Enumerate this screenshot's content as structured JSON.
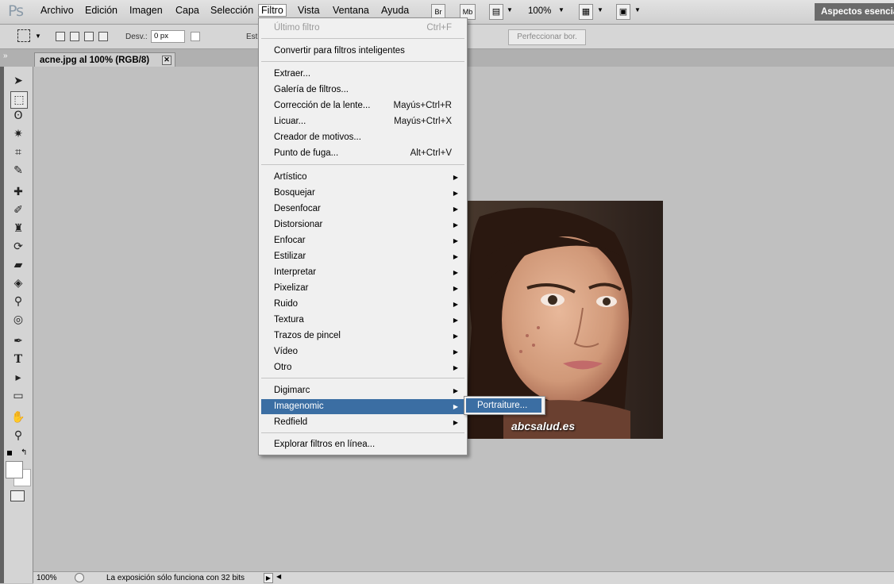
{
  "app": {
    "logo": "Ps"
  },
  "menubar": {
    "items": [
      "Archivo",
      "Edición",
      "Imagen",
      "Capa",
      "Selección",
      "Filtro",
      "Vista",
      "Ventana",
      "Ayuda"
    ],
    "bridge_label": "Br",
    "minibridge_label": "Mb",
    "zoom": "100%",
    "workspace": "Aspectos esenciales"
  },
  "options": {
    "feather_label": "Desv.:",
    "feather_value": "0 px",
    "style_label": "Esti",
    "refine_label": "Perfeccionar bor."
  },
  "document": {
    "tab_title": "acne.jpg al 100% (RGB/8)"
  },
  "photo": {
    "watermark": "abcsalud.es"
  },
  "status": {
    "zoom": "100%",
    "message": "La exposición sólo funciona con 32 bits"
  },
  "filter_menu": {
    "items": [
      {
        "label": "Último filtro",
        "shortcut": "Ctrl+F",
        "disabled": true
      },
      {
        "label": "Convertir para filtros inteligentes"
      },
      {
        "label": "Extraer..."
      },
      {
        "label": "Galería de filtros..."
      },
      {
        "label": "Corrección de la lente...",
        "shortcut": "Mayús+Ctrl+R"
      },
      {
        "label": "Licuar...",
        "shortcut": "Mayús+Ctrl+X"
      },
      {
        "label": "Creador de motivos..."
      },
      {
        "label": "Punto de fuga...",
        "shortcut": "Alt+Ctrl+V"
      },
      {
        "label": "Artístico",
        "submenu": true
      },
      {
        "label": "Bosquejar",
        "submenu": true
      },
      {
        "label": "Desenfocar",
        "submenu": true
      },
      {
        "label": "Distorsionar",
        "submenu": true
      },
      {
        "label": "Enfocar",
        "submenu": true
      },
      {
        "label": "Estilizar",
        "submenu": true
      },
      {
        "label": "Interpretar",
        "submenu": true
      },
      {
        "label": "Pixelizar",
        "submenu": true
      },
      {
        "label": "Ruido",
        "submenu": true
      },
      {
        "label": "Textura",
        "submenu": true
      },
      {
        "label": "Trazos de pincel",
        "submenu": true
      },
      {
        "label": "Vídeo",
        "submenu": true
      },
      {
        "label": "Otro",
        "submenu": true
      },
      {
        "label": "Digimarc",
        "submenu": true
      },
      {
        "label": "Imagenomic",
        "submenu": true,
        "highlighted": true
      },
      {
        "label": "Redfield",
        "submenu": true
      },
      {
        "label": "Explorar filtros en línea..."
      }
    ]
  },
  "submenu": {
    "items": [
      "Portraiture..."
    ]
  },
  "colors": {
    "highlight": "#3b6ea3",
    "canvas": "#c0c0c0"
  }
}
